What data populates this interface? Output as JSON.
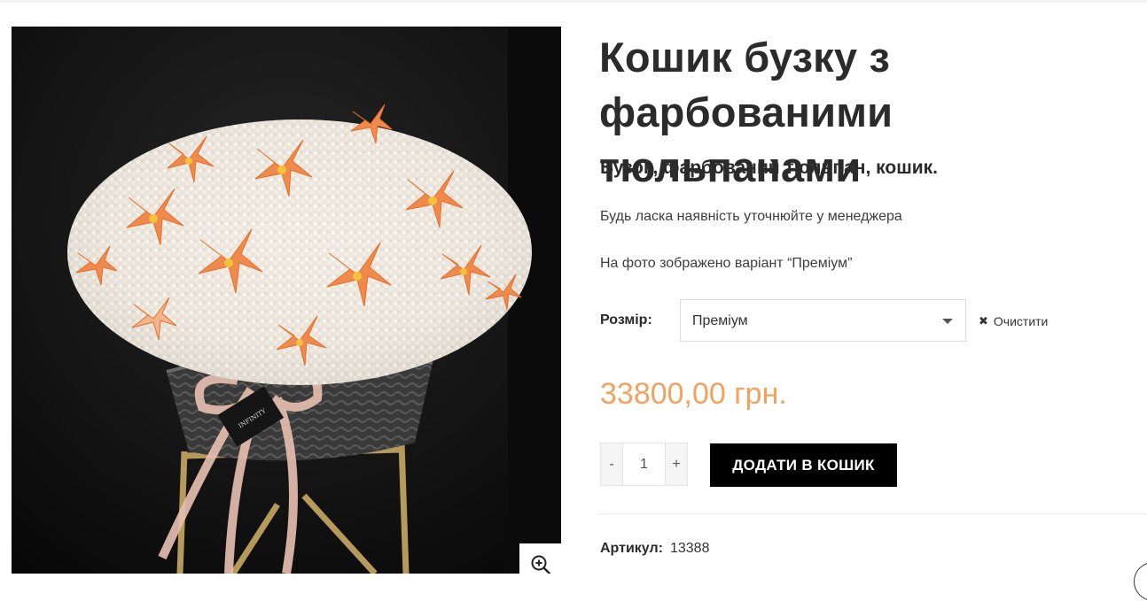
{
  "product": {
    "title_line1": "Кошик бузку з",
    "title_line2": "фарбованими тюльпанами",
    "subtitle": "Бузок, фарбований тюльпан, кошик.",
    "note_availability": "Будь ласка наявність уточнюйте у менеджера",
    "note_photo": "На фото зображено варіант “Преміум”",
    "size_label": "Розмір",
    "size_selected": "Преміум",
    "clear_label": "Очистити",
    "price": "33800,00 грн.",
    "quantity": "1",
    "qty_minus": "-",
    "qty_plus": "+",
    "add_to_cart": "ДОДАТИ В КОШИК",
    "sku_label": "Артикул:",
    "sku_value": "13388"
  },
  "image": {
    "tag_text": "INFINITY"
  },
  "icons": {
    "zoom": "zoom-in-icon",
    "clear": "close-icon",
    "select": "chevron-down-icon"
  },
  "colors": {
    "price": "#f0a25e",
    "button_bg": "#000000",
    "title": "#2b2b2b"
  }
}
